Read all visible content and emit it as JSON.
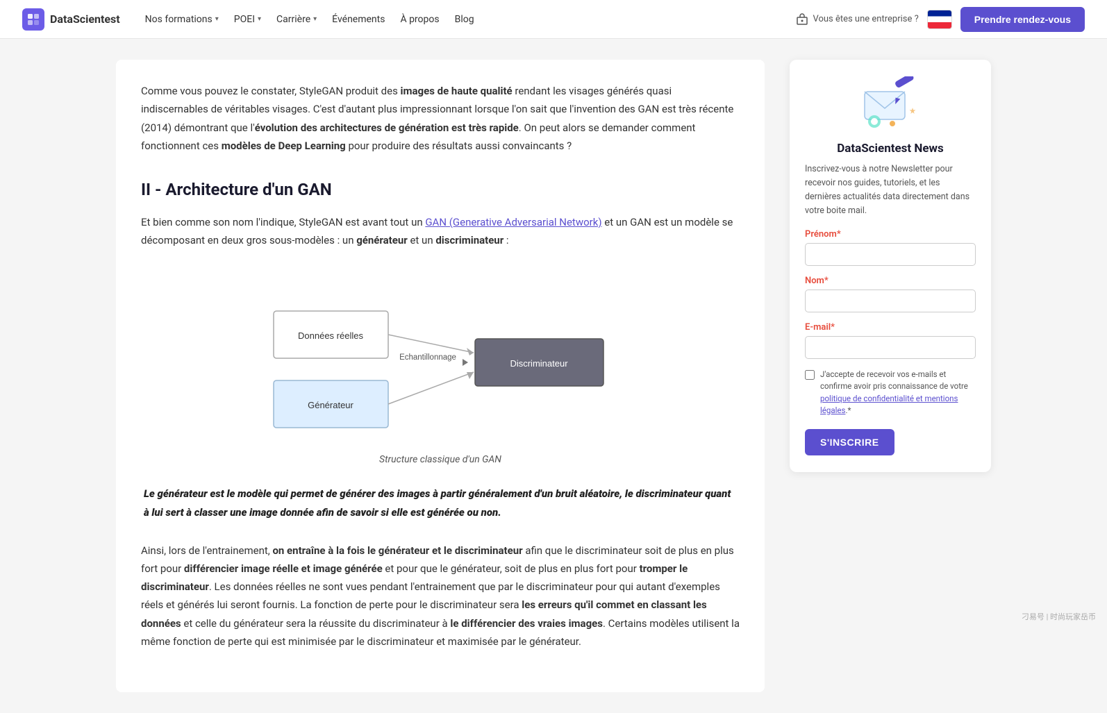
{
  "nav": {
    "logo_text": "DataScientest",
    "items": [
      {
        "label": "Nos formations",
        "has_dropdown": true
      },
      {
        "label": "POEI",
        "has_dropdown": true
      },
      {
        "label": "Carrière",
        "has_dropdown": true
      },
      {
        "label": "Événements",
        "has_dropdown": false
      },
      {
        "label": "À propos",
        "has_dropdown": false
      },
      {
        "label": "Blog",
        "has_dropdown": false
      }
    ],
    "enterprise_label": "Vous êtes une entreprise ?",
    "cta_label": "Prendre rendez-vous"
  },
  "main": {
    "intro": "Comme vous pouvez le constater, StyleGAN produit des images de haute qualité rendant les visages générés quasi indiscernables de véritables visages. C'est d'autant plus impressionnant lorsque l'on sait que l'invention des GAN est très récente (2014) démontrant que l'évolution des architectures de génération est très rapide. On peut alors se demander comment fonctionnent ces modèles de Deep Learning pour produire des résultats aussi convaincants ?",
    "section_heading": "II - Architecture d'un GAN",
    "section_text_1_before": "Et bien comme son nom l'indique, StyleGAN est avant tout un",
    "section_link_text": "GAN (Generative Adversarial Network)",
    "section_text_1_after": "et un GAN est un modèle se décomposant en deux gros sous-modèles : un générateur et un discriminateur :",
    "diagram_caption": "Structure classique d'un GAN",
    "diagram_labels": {
      "donnees": "Données réelles",
      "generateur": "Générateur",
      "echantillonnage": "Echantillonnage",
      "discriminateur": "Discriminateur"
    },
    "blockquote": "Le générateur est le modèle qui permet de générer des images à partir généralement d'un bruit aléatoire, le discriminateur quant à lui sert à classer une image donnée afin de savoir si elle est générée ou non.",
    "body_2": "Ainsi, lors de l'entrainement, on entraîne à la fois le générateur et le discriminateur afin que le discriminateur soit de plus en plus fort pour différencier image réelle et image générée et pour que le générateur, soit de plus en plus fort pour tromper le discriminateur. Les données réelles ne sont vues pendant l'entrainement que par le discriminateur pour qui autant d'exemples réels et générés lui seront fournis. La fonction de perte pour le discriminateur sera les erreurs qu'il commet en classant les données et celle du générateur sera la réussite du discriminateur à le différencier des vraies images. Certains modèles utilisent la même fonction de perte qui est minimisée par le discriminateur et maximisée par le générateur."
  },
  "sidebar": {
    "newsletter": {
      "title": "DataScientest News",
      "description": "Inscrivez-vous à notre Newsletter pour recevoir nos guides, tutoriels, et les dernières actualités data directement dans votre boite mail.",
      "prenom_label": "Prénom",
      "prenom_required": "*",
      "nom_label": "Nom",
      "nom_required": "*",
      "email_label": "E-mail",
      "email_required": "*",
      "consent_text": "J'accepte de recevoir vos e-mails et confirme avoir pris connaissance de votre politique de confidentialité et mentions légales.",
      "consent_required": "*",
      "subscribe_label": "S'INSCRIRE"
    }
  },
  "watermark": "刁易号 | 时尚玩家岳币"
}
